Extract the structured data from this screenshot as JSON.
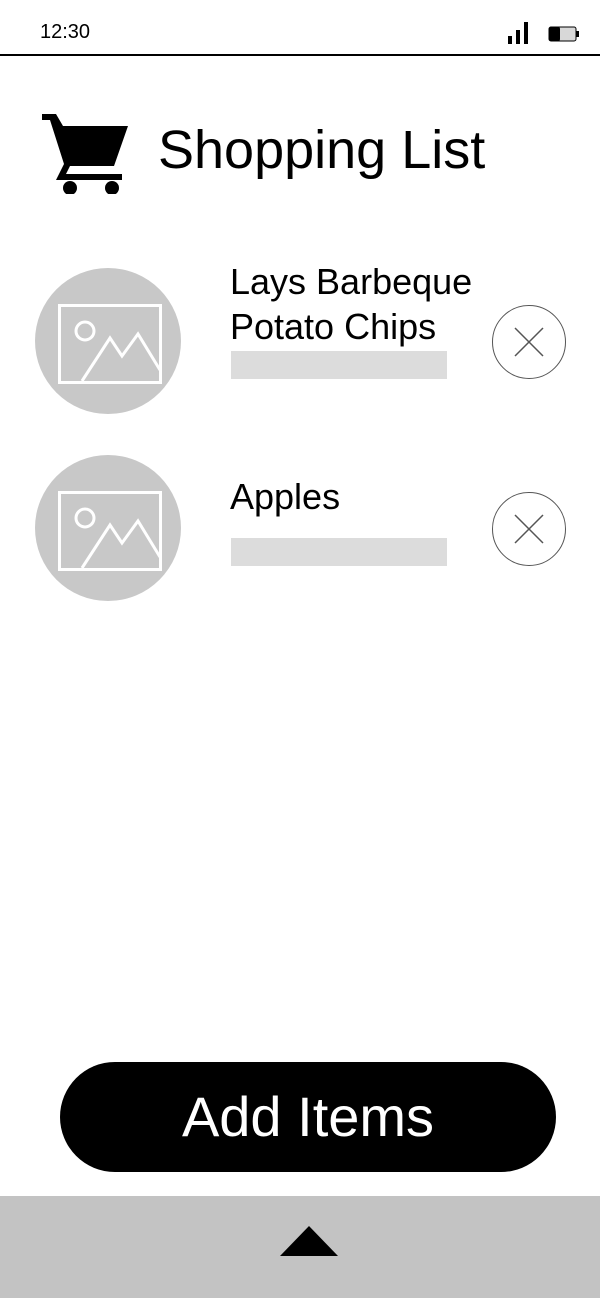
{
  "status_bar": {
    "time": "12:30",
    "icons": [
      "signal-icon",
      "battery-icon"
    ]
  },
  "header": {
    "icon": "shopping-cart-icon",
    "title": "Shopping List"
  },
  "items": [
    {
      "name": "Lays Barbeque Potato Chips",
      "image_icon": "image-placeholder-icon",
      "remove_icon": "close-icon"
    },
    {
      "name": "Apples",
      "image_icon": "image-placeholder-icon",
      "remove_icon": "close-icon"
    }
  ],
  "add_button": {
    "label": "Add Items"
  },
  "bottom_bar": {
    "icon": "caret-up-icon"
  },
  "colors": {
    "placeholder_circle": "#c8c8c8",
    "placeholder_bar": "#dcdcdc",
    "bottom_bar": "#c3c3c3",
    "button": "#000000",
    "button_text": "#ffffff"
  }
}
